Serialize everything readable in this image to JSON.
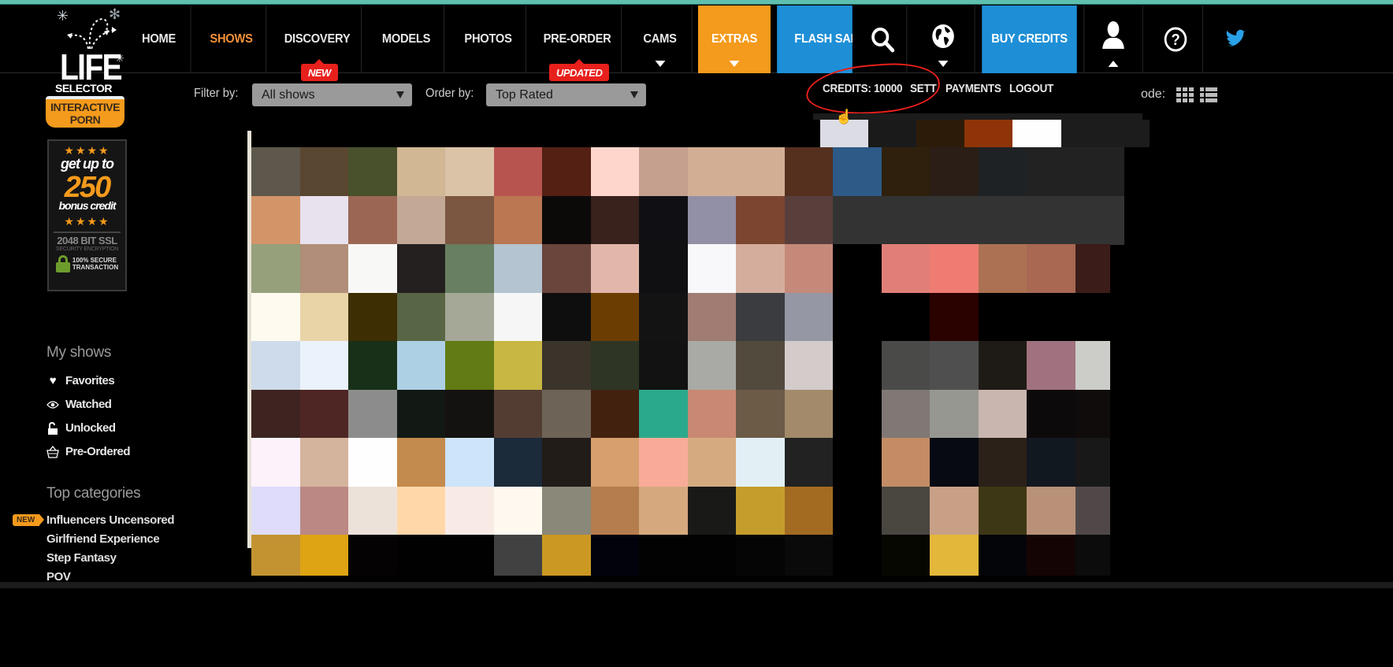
{
  "logo": {
    "line1": "LIFE",
    "line2": "SELECTOR",
    "badge": "INTERACTIVE PORN"
  },
  "nav": {
    "items": [
      {
        "label": "HOME",
        "state": "default"
      },
      {
        "label": "SHOWS",
        "state": "active"
      },
      {
        "label": "DISCOVERY",
        "state": "default",
        "badge": "NEW"
      },
      {
        "label": "MODELS",
        "state": "default"
      },
      {
        "label": "PHOTOS",
        "state": "default"
      },
      {
        "label": "PRE-ORDER",
        "state": "default",
        "badge": "UPDATED"
      },
      {
        "label": "CAMS",
        "state": "default",
        "dropdown": true
      },
      {
        "label": "EXTRAS",
        "state": "highlight-orange",
        "dropdown": true
      },
      {
        "label": "FLASH SALE",
        "state": "highlight-blue"
      },
      {
        "label": "BUY CREDITS",
        "state": "highlight-blue"
      }
    ],
    "icons": [
      "search-icon",
      "globe-icon",
      "user-icon",
      "help-icon",
      "twitter-icon"
    ]
  },
  "filters": {
    "filter_label": "Filter by:",
    "filter_value": "All shows",
    "order_label": "Order by:",
    "order_value": "Top Rated"
  },
  "account": {
    "credits": "CREDITS: 10000",
    "settings": "SETT",
    "payments": "PAYMENTS",
    "logout": "LOGOUT",
    "view_mode_label": "ode:"
  },
  "bonus": {
    "stars": "★★★★",
    "line1": "get up to",
    "amount": "250",
    "line2": "bonus credit",
    "ssl_title": "2048 BIT SSL",
    "ssl_sub": "SECURITY ENCRYPTION",
    "secure_line1": "100% SECURE",
    "secure_line2": "TRANSACTION"
  },
  "sidebar": {
    "my_shows_heading": "My shows",
    "my_shows": [
      {
        "label": "Favorites",
        "icon": "heart-icon"
      },
      {
        "label": "Watched",
        "icon": "eye-icon"
      },
      {
        "label": "Unlocked",
        "icon": "unlock-icon"
      },
      {
        "label": "Pre-Ordered",
        "icon": "basket-icon"
      }
    ],
    "categories_heading": "Top categories",
    "new_tag": "NEW",
    "categories": [
      "Influencers Uncensored",
      "Girlfriend Experience",
      "Step Fantasy",
      "POV"
    ]
  },
  "colors": {
    "accent_orange": "#f49a1c",
    "accent_blue": "#1e8fd6",
    "active_nav": "#f4913b",
    "badge_red": "#e8201c",
    "annotation_red": "#e8201c"
  },
  "mosaic": {
    "rows": [
      [
        "#5e574c",
        "#5a4731",
        "#48502c",
        "#d2b794",
        "#dbc3a8",
        "#b85450",
        "#532013",
        "#fed6cc",
        "#c5a08f",
        "#d2ae95",
        "#d2ae95",
        "#55301f",
        "#2d5a87",
        "#2e200c",
        "#2a1e16",
        "#1f2224",
        "#222222",
        "#222222"
      ],
      [
        "#d39468",
        "#e8e2ee",
        "#9b6754",
        "#c4a896",
        "#7b5641",
        "#bb7652",
        "#0b0a09",
        "#38221b",
        "#101014",
        "#9290a6",
        "#7b4530",
        "#583f3c",
        "#333333",
        "#333333",
        "#333333",
        "#333333",
        "#333333",
        "#333333"
      ],
      [
        "#96a07a",
        "#b08e79",
        "#f8f8f6",
        "#242020",
        "#697f61",
        "#b4c4d0",
        "#6a453c",
        "#e3b6aa",
        "#101013",
        "#f8f8fa",
        "#d5ad9c",
        "#c5897a",
        "#000000",
        "#e07f78",
        "#ee7c72",
        "#ac7152",
        "#a86852",
        "#3c1c18"
      ],
      [
        "#fefaf0",
        "#e9d4a8",
        "#3d2e03",
        "#596645",
        "#a5a797",
        "#f6f6f6",
        "#0e0e0e",
        "#6c3d03",
        "#131314",
        "#a07c72",
        "#3a3c40",
        "#9597a4",
        "#000000",
        "#000000",
        "#2a0200",
        "#000000",
        "#000000",
        "#000000"
      ],
      [
        "#cddbea",
        "#eaf2fc",
        "#173017",
        "#aed0e4",
        "#627b14",
        "#c9b743",
        "#3b342a",
        "#2e3524",
        "#121212",
        "#a9aaa5",
        "#534a3e",
        "#d3cccb",
        "#000000",
        "#4a4a48",
        "#4f4f4f",
        "#1e1a15",
        "#a07280",
        "#cccdc8"
      ],
      [
        "#3e2420",
        "#4e2624",
        "#8c8c8c",
        "#121814",
        "#141210",
        "#533d33",
        "#6d6357",
        "#43210f",
        "#2ba98c",
        "#c98873",
        "#6b5b47",
        "#a28a6a",
        "#000000",
        "#807874",
        "#979791",
        "#c9b6af",
        "#0d0a0b",
        "#110c0c"
      ],
      [
        "#fef2fa",
        "#d4b49d",
        "#fefefe",
        "#c38b4d",
        "#cde4fa",
        "#1c2b3a",
        "#211c18",
        "#d59f6e",
        "#f8ab98",
        "#d5aa80",
        "#e2f0f6",
        "#222222",
        "#000000",
        "#c38c65",
        "#070a12",
        "#2c2118",
        "#121820",
        "#181818"
      ],
      [
        "#dedcfa",
        "#bb8884",
        "#ede2da",
        "#ffd7a9",
        "#f8ebe6",
        "#fff9f0",
        "#8a8878",
        "#b47d4e",
        "#d6a87e",
        "#191918",
        "#c59d2c",
        "#a36b21",
        "#000000",
        "#4a4640",
        "#c8a086",
        "#3e3715",
        "#b99178",
        "#504848"
      ],
      [
        "#c39332",
        "#dea413",
        "#050203",
        "#020101",
        "#020101",
        "#414141",
        "#cb9822",
        "#02020c",
        "#020202",
        "#020202",
        "#050505",
        "#0a0a0a",
        "#000000",
        "#070702",
        "#e3b73a",
        "#040508",
        "#150404",
        "#0c0c0c"
      ]
    ]
  }
}
